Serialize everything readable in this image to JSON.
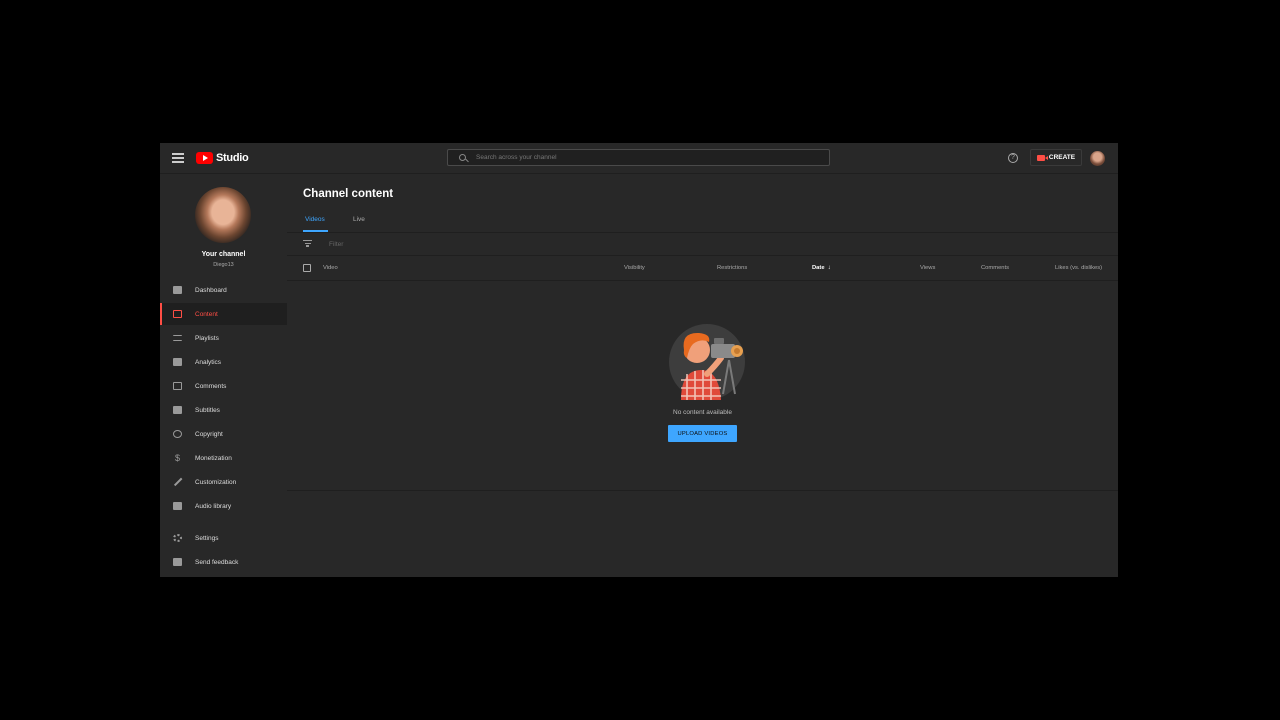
{
  "header": {
    "logo_text": "Studio",
    "search_placeholder": "Search across your channel",
    "create_label": "CREATE"
  },
  "sidebar": {
    "channel_name": "Your channel",
    "channel_handle": "Diego13",
    "items": [
      {
        "label": "Dashboard",
        "icon": "dashboard-icon",
        "active": false
      },
      {
        "label": "Content",
        "icon": "content-icon",
        "active": true
      },
      {
        "label": "Playlists",
        "icon": "playlists-icon",
        "active": false
      },
      {
        "label": "Analytics",
        "icon": "analytics-icon",
        "active": false
      },
      {
        "label": "Comments",
        "icon": "comments-icon",
        "active": false
      },
      {
        "label": "Subtitles",
        "icon": "subtitles-icon",
        "active": false
      },
      {
        "label": "Copyright",
        "icon": "copyright-icon",
        "active": false
      },
      {
        "label": "Monetization",
        "icon": "dollar-icon",
        "active": false
      },
      {
        "label": "Customization",
        "icon": "wand-icon",
        "active": false
      },
      {
        "label": "Audio library",
        "icon": "audio-library-icon",
        "active": false
      },
      {
        "label": "Settings",
        "icon": "gear-icon",
        "active": false
      },
      {
        "label": "Send feedback",
        "icon": "feedback-icon",
        "active": false
      }
    ]
  },
  "main": {
    "title": "Channel content",
    "tabs": [
      {
        "label": "Videos",
        "active": true
      },
      {
        "label": "Live",
        "active": false
      }
    ],
    "filter_placeholder": "Filter",
    "columns": {
      "video": "Video",
      "visibility": "Visibility",
      "restrictions": "Restrictions",
      "date": "Date",
      "views": "Views",
      "comments": "Comments",
      "likes": "Likes (vs. dislikes)"
    },
    "empty_text": "No content available",
    "upload_label": "UPLOAD VIDEOS"
  },
  "colors": {
    "accent_blue": "#3ea6ff",
    "accent_red": "#ff4e45",
    "background": "#282828"
  }
}
